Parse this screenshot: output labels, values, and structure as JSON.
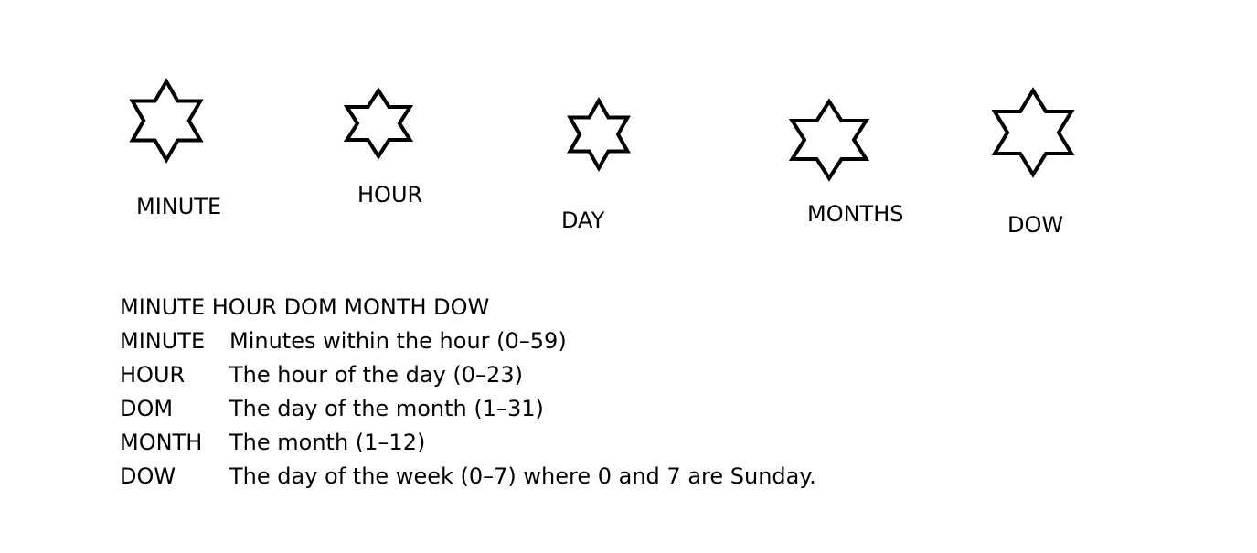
{
  "fields": [
    {
      "id": "minute",
      "label": "MINUTE"
    },
    {
      "id": "hour",
      "label": "HOUR"
    },
    {
      "id": "day",
      "label": "DAY"
    },
    {
      "id": "months",
      "label": "MONTHS"
    },
    {
      "id": "dow",
      "label": "DOW"
    }
  ],
  "legend": {
    "header": "MINUTE HOUR DOM MONTH DOW",
    "rows": [
      {
        "key": "MINUTE",
        "desc": "Minutes within the hour (0–59)"
      },
      {
        "key": "HOUR",
        "desc": "The hour of the day (0–23)"
      },
      {
        "key": "DOM",
        "desc": "The day of the month (1–31)"
      },
      {
        "key": "MONTH",
        "desc": "The month (1–12)"
      },
      {
        "key": "DOW",
        "desc": "The day of the week (0–7) where 0 and 7 are Sunday."
      }
    ]
  },
  "icons": {
    "field_marker": "six-pointed-star-icon"
  }
}
